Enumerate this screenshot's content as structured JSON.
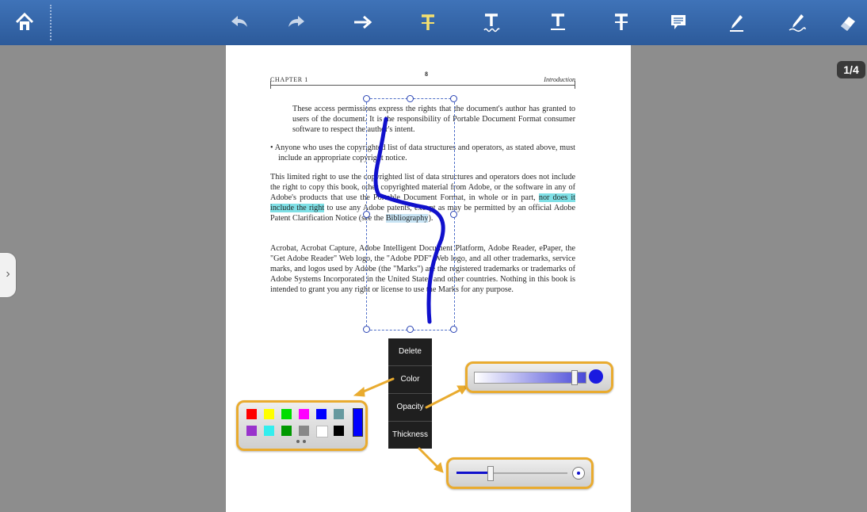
{
  "toolbar": {
    "home_icon": "home-icon",
    "tools": [
      "undo-icon",
      "redo-icon",
      "arrow-tool-icon",
      "strikeout-text-icon",
      "squiggly-underline-text-icon",
      "underline-text-icon",
      "strikethrough-text-icon",
      "comment-note-icon",
      "highlight-pen-icon",
      "freehand-pen-icon",
      "eraser-icon"
    ],
    "accent_color": "#2c5a9a",
    "highlight_tool_color": "#f5e06e"
  },
  "viewer": {
    "page_indicator": "1/4",
    "side_panel_toggle": "›"
  },
  "document": {
    "running_head_left": "CHAPTER 1",
    "running_head_page": "8",
    "running_head_right": "Introduction",
    "para1": "These access permissions express the rights that the document's author has granted to users of the document. It is the responsibility of Portable Document Format consumer software to respect the author's intent.",
    "bullet": "• Anyone who uses the copyrighted list of data structures and operators, as stated above, must include an appropriate copyright notice.",
    "para2_start": "This limited right to use the copyrighted list of data structures and operators does not include the right to copy this book, other copyrighted material from Adobe, or the software in any of Adobe's products that use the Portable Document Format, in whole or in part, ",
    "para2_highlight": "nor does it include the right",
    "para2_mid": " to use any Adobe patents, except as may be permitted by an official Adobe Patent Clarification Notice (see the ",
    "para2_link": "Bibliography",
    "para2_end": ").",
    "para3": "Acrobat, Acrobat Capture, Adobe Intelligent Document Platform, Adobe Reader, ePaper, the \"Get Adobe Reader\" Web logo, the \"Adobe PDF\" Web logo, and all other trademarks, service marks, and logos used by Adobe (the \"Marks\") are the registered trademarks or trademarks of Adobe Systems Incorporated in the United States and other countries. Nothing in this book is intended to grant you any right or license to use the Marks for any purpose."
  },
  "context_menu": {
    "delete": "Delete",
    "color": "Color",
    "opacity": "Opacity",
    "thickness": "Thickness"
  },
  "color_palette": {
    "swatches": [
      "#ff0000",
      "#ffff00",
      "#00dd00",
      "#ff00ff",
      "#0000ff",
      "#66999f",
      "#9933cc",
      "#33eeee",
      "#009900",
      "#888888",
      "#ffffff",
      "#000000"
    ],
    "selected_color": "#0000ff"
  },
  "opacity_slider": {
    "value_fraction": 0.9
  },
  "thickness_slider": {
    "value_fraction": 0.3
  },
  "ink_color": "#1010cc",
  "callout_color": "#e9ab2f"
}
